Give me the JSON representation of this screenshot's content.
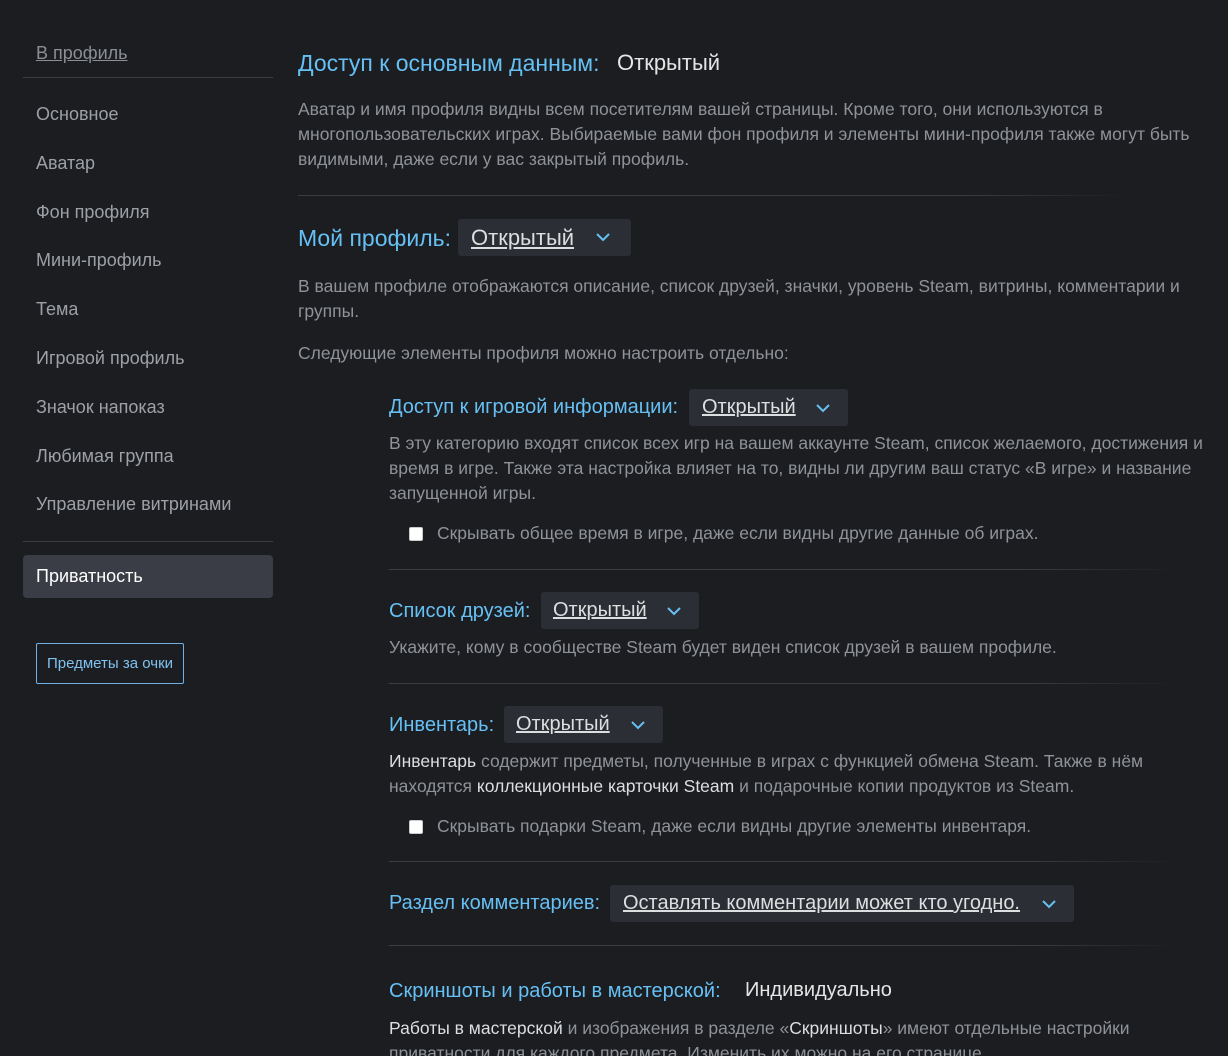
{
  "sidebar": {
    "back_link": "В профиль",
    "items": [
      {
        "label": "Основное"
      },
      {
        "label": "Аватар"
      },
      {
        "label": "Фон профиля"
      },
      {
        "label": "Мини-профиль"
      },
      {
        "label": "Тема"
      },
      {
        "label": "Игровой профиль"
      },
      {
        "label": "Значок напоказ"
      },
      {
        "label": "Любимая группа"
      },
      {
        "label": "Управление витринами"
      }
    ],
    "active_item": "Приватность",
    "points_button": "Предметы за очки"
  },
  "basic": {
    "title": "Доступ к основным данным:",
    "value": "Открытый",
    "description": "Аватар и имя профиля видны всем посетителям вашей страницы. Кроме того, они используются в многопользовательских играх. Выбираемые вами фон профиля и элементы мини-профиля также могут быть видимыми, даже если у вас закрытый профиль."
  },
  "my_profile": {
    "title": "Мой профиль:",
    "value": "Открытый",
    "description": "В вашем профиле отображаются описание, список друзей, значки, уровень Steam, витрины, комментарии и группы.",
    "note": "Следующие элементы профиля можно настроить отдельно:"
  },
  "game_info": {
    "title": "Доступ к игровой информации:",
    "value": "Открытый",
    "description": "В эту категорию входят список всех игр на вашем аккаунте Steam, список желаемого, достижения и время в игре. Также эта настройка влияет на то, видны ли другим ваш статус «В игре» и название запущенной игры.",
    "checkbox_label": "Скрывать общее время в игре, даже если видны другие данные об играх."
  },
  "friends": {
    "title": "Список друзей:",
    "value": "Открытый",
    "description": "Укажите, кому в сообществе Steam будет виден список друзей в вашем профиле."
  },
  "inventory": {
    "title": "Инвентарь:",
    "value": "Открытый",
    "desc_b1": "Инвентарь",
    "desc_t1": " содержит предметы, полученные в играх с функцией обмена Steam. Также в нём находятся ",
    "desc_b2": "коллекционные карточки Steam",
    "desc_t2": " и подарочные копии продуктов из Steam.",
    "checkbox_label": "Скрывать подарки Steam, даже если видны другие элементы инвентаря."
  },
  "comments": {
    "title": "Раздел комментариев:",
    "value": "Оставлять комментарии может кто угодно."
  },
  "screenshots": {
    "title": "Скриншоты и работы в мастерской:",
    "value": "Индивидуально",
    "desc_b1": "Работы в мастерской",
    "desc_t1": " и изображения в разделе «",
    "desc_b2": "Скриншоты",
    "desc_t2": "» имеют отдельные настройки приватности для каждого предмета. Изменить их можно на его странице."
  },
  "colors": {
    "background": "#1b1d21",
    "accent": "#66c0f4",
    "dropdown_bg": "#2b2e34",
    "sidebar_active_bg": "#3a3d45"
  }
}
